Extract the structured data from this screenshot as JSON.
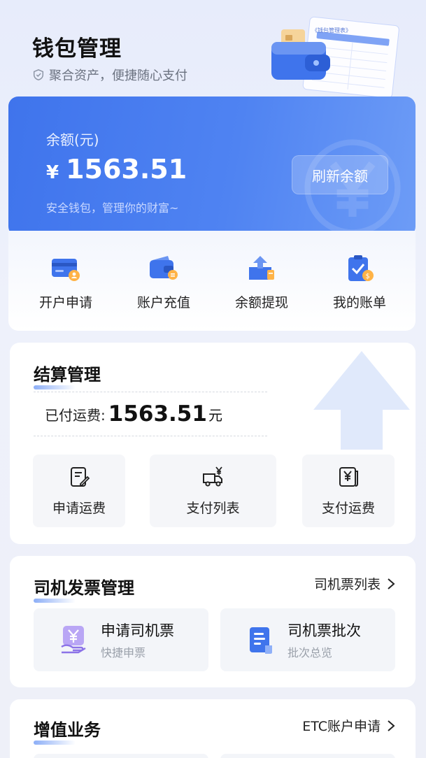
{
  "header": {
    "title": "钱包管理",
    "subtitle": "聚合资产，便捷随心支付",
    "illustration_text": "《钱包管理表》"
  },
  "balance": {
    "label": "余额(元)",
    "currency_symbol": "¥",
    "value": "1563.51",
    "tip": "安全钱包，管理你的财富~",
    "refresh_label": "刷新余额"
  },
  "quick_actions": [
    {
      "label": "开户申请",
      "icon": "card-user-icon"
    },
    {
      "label": "账户充值",
      "icon": "wallet-coin-icon"
    },
    {
      "label": "余额提现",
      "icon": "withdraw-icon"
    },
    {
      "label": "我的账单",
      "icon": "bill-icon"
    }
  ],
  "settlement": {
    "title": "结算管理",
    "paid_label": "已付运费:",
    "paid_value": "1563.51",
    "paid_unit": "元",
    "tiles": [
      {
        "label": "申请运费",
        "icon": "edit-document-icon"
      },
      {
        "label": "支付列表",
        "icon": "truck-yen-icon"
      },
      {
        "label": "支付运费",
        "icon": "yen-receipt-icon"
      }
    ]
  },
  "driver_invoice": {
    "title": "司机发票管理",
    "link": "司机票列表",
    "tiles": [
      {
        "main": "申请司机票",
        "sub": "快捷申票",
        "icon": "yen-hand-icon"
      },
      {
        "main": "司机票批次",
        "sub": "批次总览",
        "icon": "document-list-icon"
      }
    ]
  },
  "value_added": {
    "title": "增值业务",
    "link": "ETC账户申请"
  },
  "colors": {
    "accent": "#4F83F2",
    "card_gradient_start": "#3F74EC",
    "card_gradient_end": "#6D9CF6",
    "page_bg": "#E9EDFA"
  }
}
